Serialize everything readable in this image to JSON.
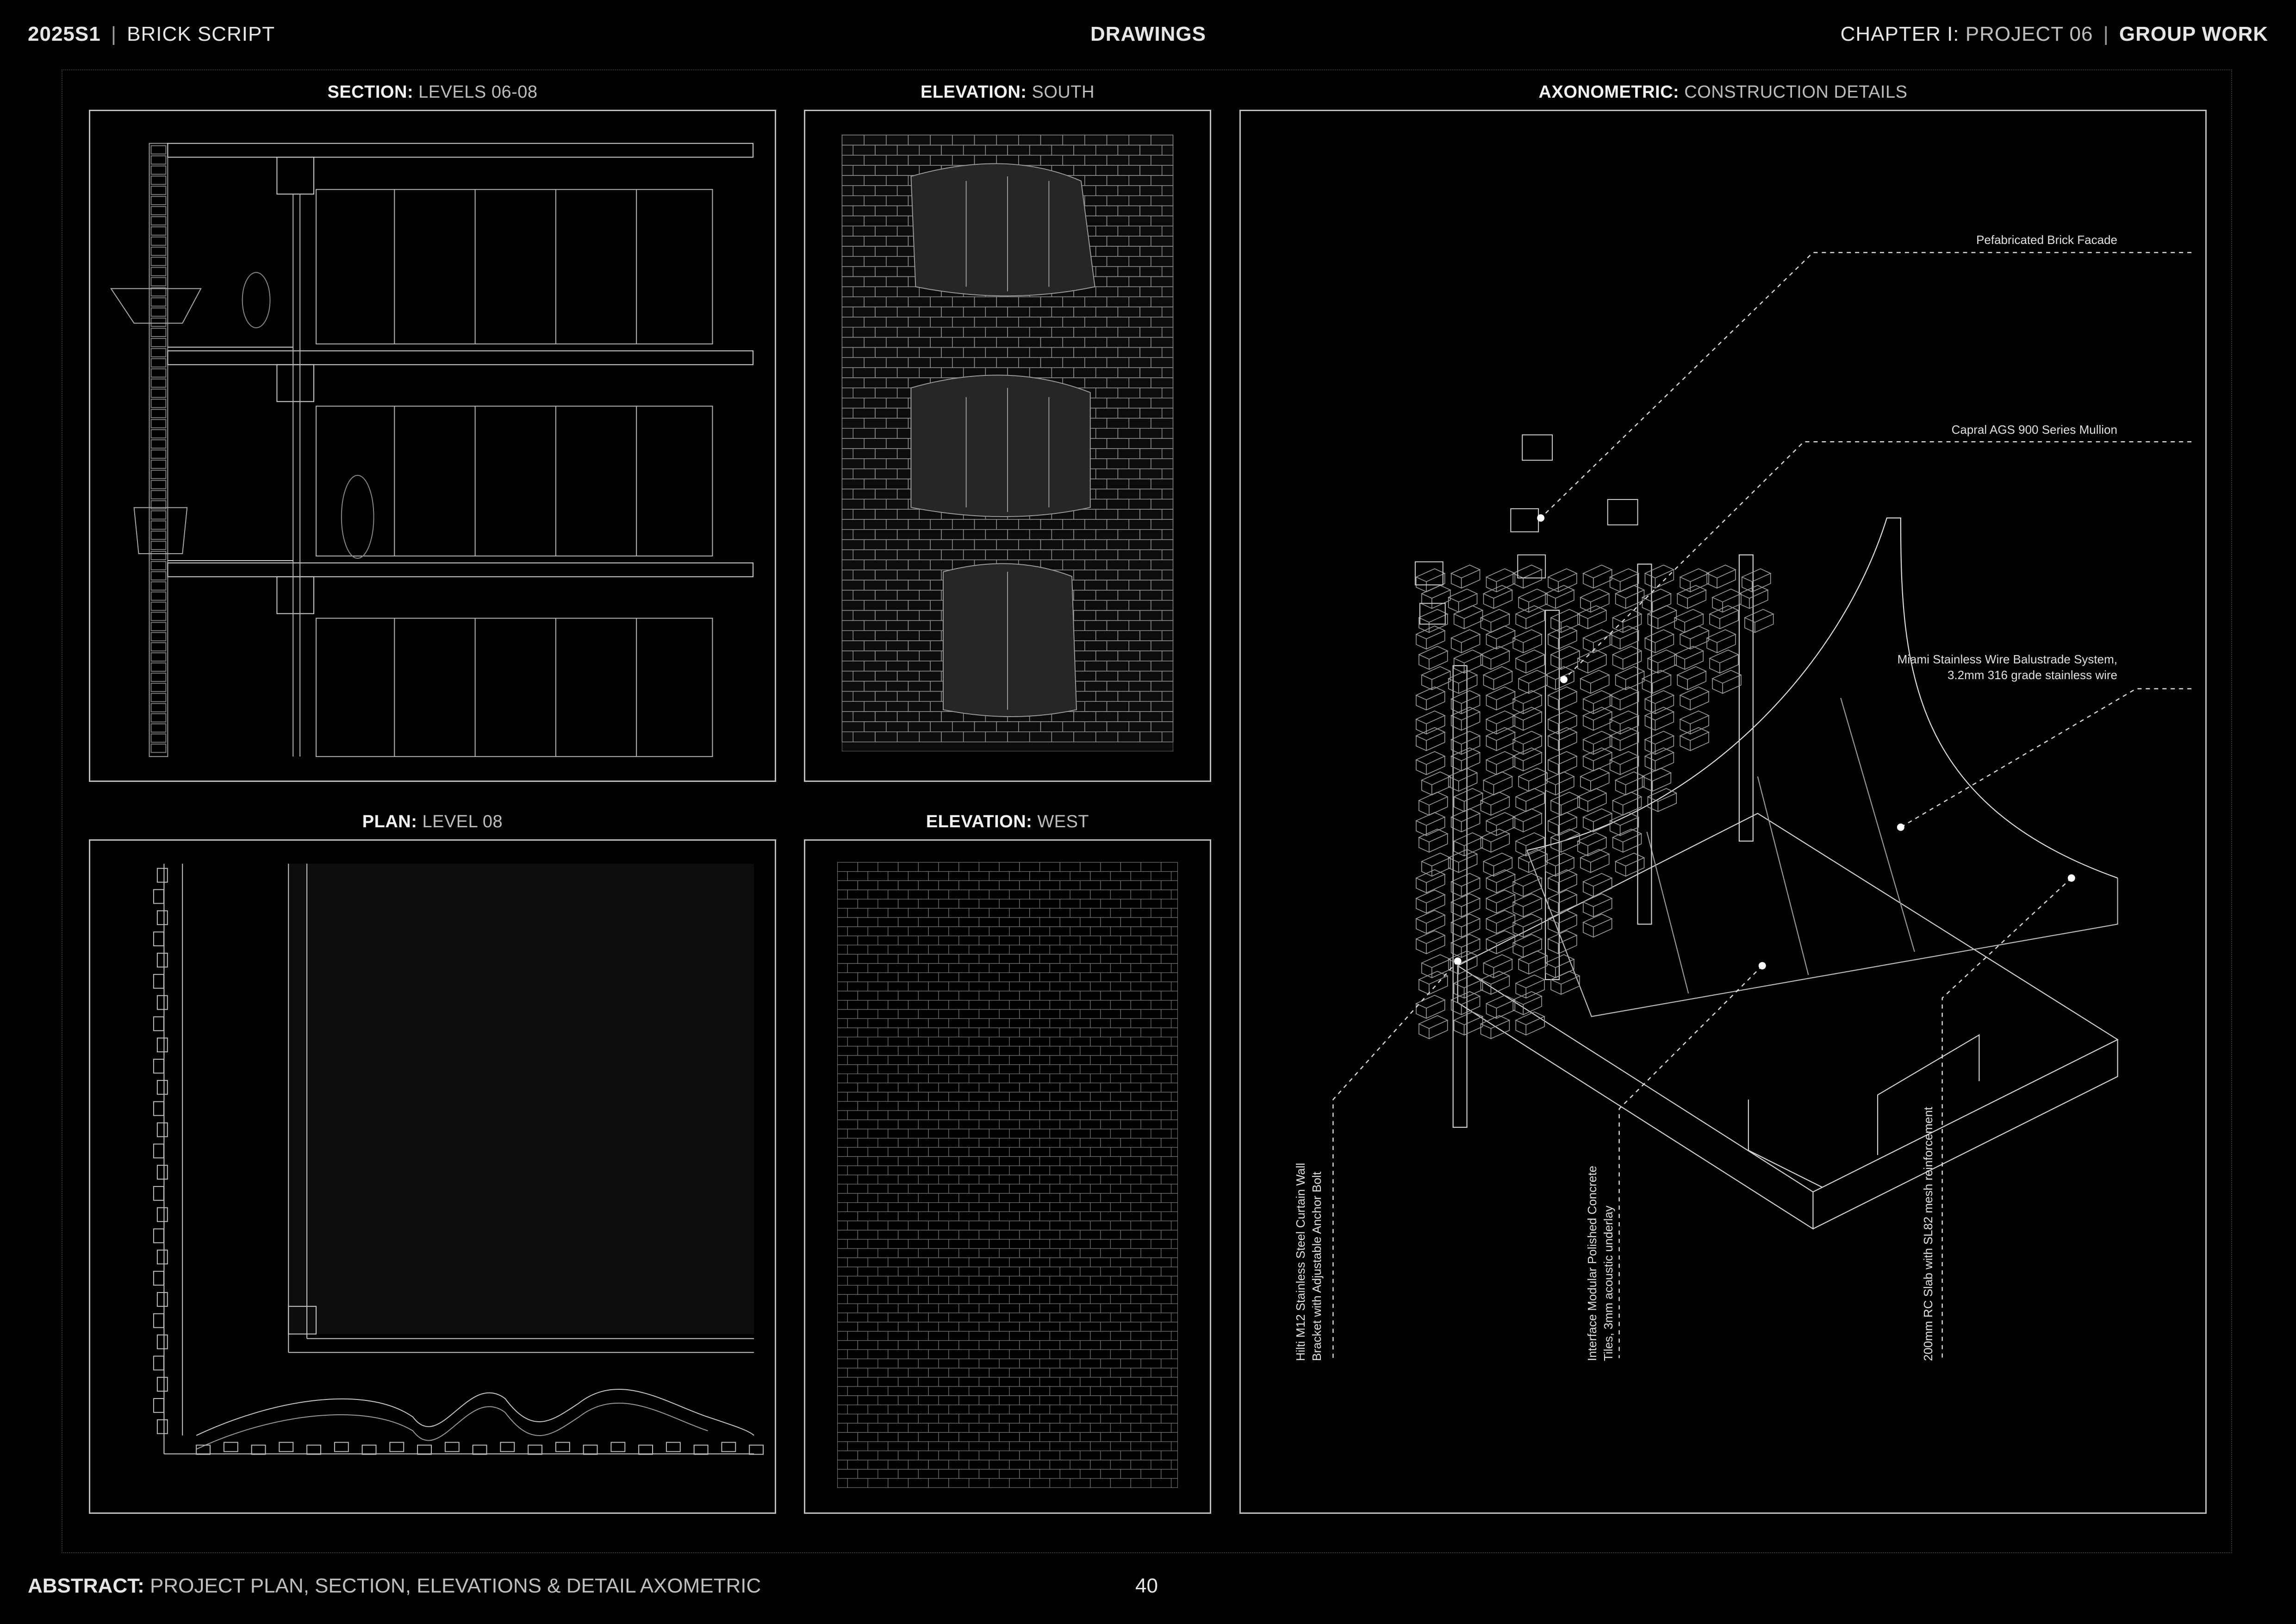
{
  "header": {
    "term": "2025S1",
    "separator": "|",
    "project_name": "BRICK SCRIPT",
    "section_title": "DRAWINGS",
    "chapter_label": "CHAPTER I:",
    "chapter_project": "PROJECT 06",
    "group_work": "GROUP WORK"
  },
  "panels": {
    "section": {
      "label": "SECTION:",
      "sub": "LEVELS 06-08"
    },
    "elevation_south": {
      "label": "ELEVATION:",
      "sub": "SOUTH"
    },
    "axonometric": {
      "label": "AXONOMETRIC:",
      "sub": "CONSTRUCTION DETAILS"
    },
    "plan": {
      "label": "PLAN:",
      "sub": "LEVEL 08"
    },
    "elevation_west": {
      "label": "ELEVATION:",
      "sub": "WEST"
    }
  },
  "callouts": {
    "brick_facade": "Pefabricated Brick Facade",
    "mullion": "Capral AGS 900 Series Mullion",
    "balustrade_line1": "Miami Stainless Wire Balustrade System,",
    "balustrade_line2": "3.2mm 316 grade stainless wire",
    "bracket_line1": "Hilti M12 Stainless Steel Curtain Wall",
    "bracket_line2": "Bracket with Adjustable Anchor Bolt",
    "tiles_line1": "Interface Modular Polished Concrete",
    "tiles_line2": "Tiles, 3mm acoustic underlay",
    "slab": "200mm RC Slab with SL82 mesh reinforcement"
  },
  "footer": {
    "label": "ABSTRACT:",
    "text": "PROJECT PLAN, SECTION, ELEVATIONS & DETAIL AXOMETRIC",
    "page_number": "40"
  },
  "colors": {
    "background": "#000000",
    "linework": "#d9d9d9",
    "frame": "#bdbdbd"
  }
}
